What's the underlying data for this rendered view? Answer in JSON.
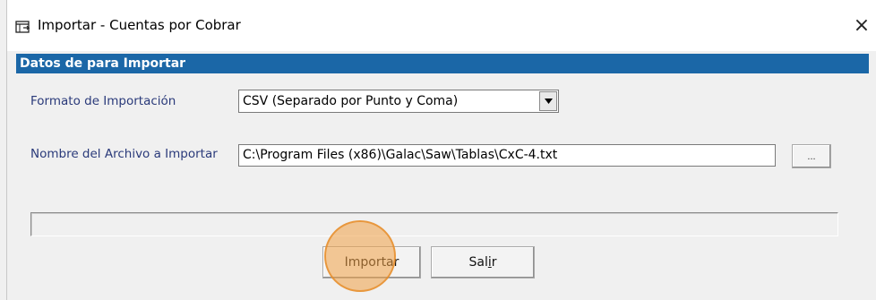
{
  "window": {
    "title": "Importar - Cuentas por Cobrar",
    "close_glyph": "×"
  },
  "section": {
    "header": "Datos de para  Importar"
  },
  "form": {
    "format_label": "Formato de Importación",
    "format_value": "CSV (Separado por Punto y Coma)",
    "file_label": "Nombre del Archivo a Importar",
    "file_value": "C:\\Program Files (x86)\\Galac\\Saw\\Tablas\\CxC-4.txt",
    "browse_label": "..."
  },
  "progress": {
    "value": 0
  },
  "buttons": {
    "importar_label": "Importar",
    "salir_prefix": "Sal",
    "salir_accel": "i",
    "salir_suffix": "r"
  },
  "icons": {
    "window_icon": "window-table-icon",
    "dropdown_arrow": "triangle-down-icon"
  },
  "colors": {
    "header_bg": "#1b67a7",
    "label_text": "#2a3a7a",
    "highlight": "#f0a046"
  }
}
